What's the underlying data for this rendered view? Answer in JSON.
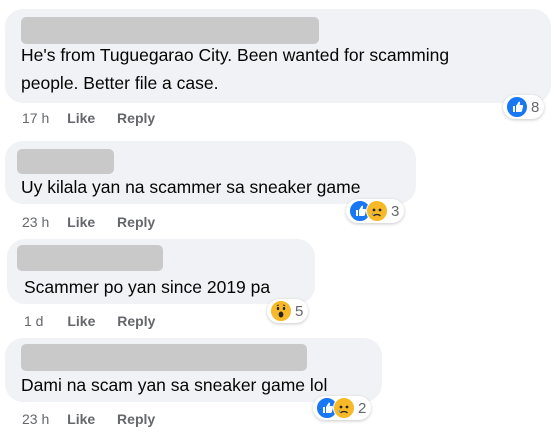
{
  "comments": [
    {
      "text_lines": [
        "He's from Tuguegarao City. Been wanted for scamming",
        "people. Better file a case."
      ],
      "time": "17 h",
      "like_label": "Like",
      "reply_label": "Reply",
      "reactions": [
        "like-icon"
      ],
      "reaction_count": "8"
    },
    {
      "text_lines": [
        "Uy kilala yan na scammer sa sneaker game"
      ],
      "time": "23 h",
      "like_label": "Like",
      "reply_label": "Reply",
      "reactions": [
        "like-icon",
        "sad-icon"
      ],
      "reaction_count": "3"
    },
    {
      "text_lines": [
        "Scammer po yan since 2019 pa"
      ],
      "time": "1 d",
      "like_label": "Like",
      "reply_label": "Reply",
      "reactions": [
        "wow-icon"
      ],
      "reaction_count": "5"
    },
    {
      "text_lines": [
        "Dami na scam yan sa sneaker game lol"
      ],
      "time": "23 h",
      "like_label": "Like",
      "reply_label": "Reply",
      "reactions": [
        "like-icon",
        "sad-icon"
      ],
      "reaction_count": "2"
    }
  ],
  "colors": {
    "bubble": "#f0f2f5",
    "redaction": "#c9c9c9",
    "like_blue": "#1877f2",
    "emoji_yellow": "#f7b928",
    "meta_gray": "#65676b"
  }
}
